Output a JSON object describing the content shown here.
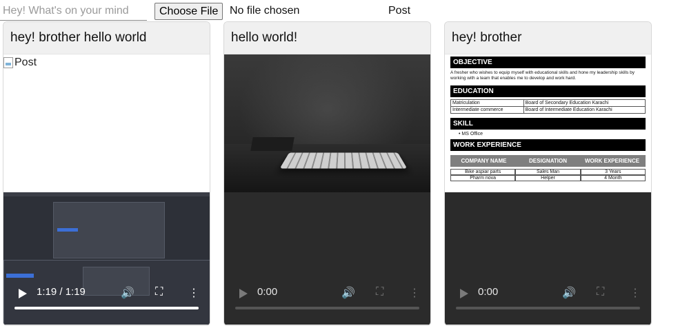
{
  "composer": {
    "placeholder": "Hey! What's on your mind",
    "file_button": "Choose File",
    "file_status": "No file chosen",
    "post_label": "Post"
  },
  "posts": [
    {
      "title": "hey! brother hello world",
      "image_alt": "Post",
      "image_state": "broken",
      "video": {
        "time": "1:19 / 1:19",
        "progress": 1.0
      }
    },
    {
      "title": "hello world!",
      "image_state": "keyboard-photo",
      "video": {
        "time": "0:00",
        "progress": 0.0
      }
    },
    {
      "title": "hey! brother",
      "image_state": "resume",
      "resume": {
        "objective_heading": "OBJECTIVE",
        "objective_text": "A fresher who wishes to equip myself with educational skills and hone my leadership skills by working with a team that enables me to develop and work hard.",
        "education_heading": "EDUCATION",
        "education_rows": [
          [
            "Matriculation",
            "Board of Secondary Education Karachi"
          ],
          [
            "Intermediate commerce",
            "Board of Intermediate Education Karachi"
          ]
        ],
        "skill_heading": "SKILL",
        "skills": [
          "MS Office"
        ],
        "work_heading": "WORK EXPERIENCE",
        "work_columns": [
          "COMPANY NAME",
          "DESIGNATION",
          "WORK EXPERIENCE"
        ],
        "work_rows": [
          [
            "Bike aspiar parts",
            "Sales Man",
            "3 Years"
          ],
          [
            "Pharm nova",
            "Helper",
            "4 Month"
          ]
        ]
      },
      "video": {
        "time": "0:00",
        "progress": 0.0
      }
    }
  ]
}
